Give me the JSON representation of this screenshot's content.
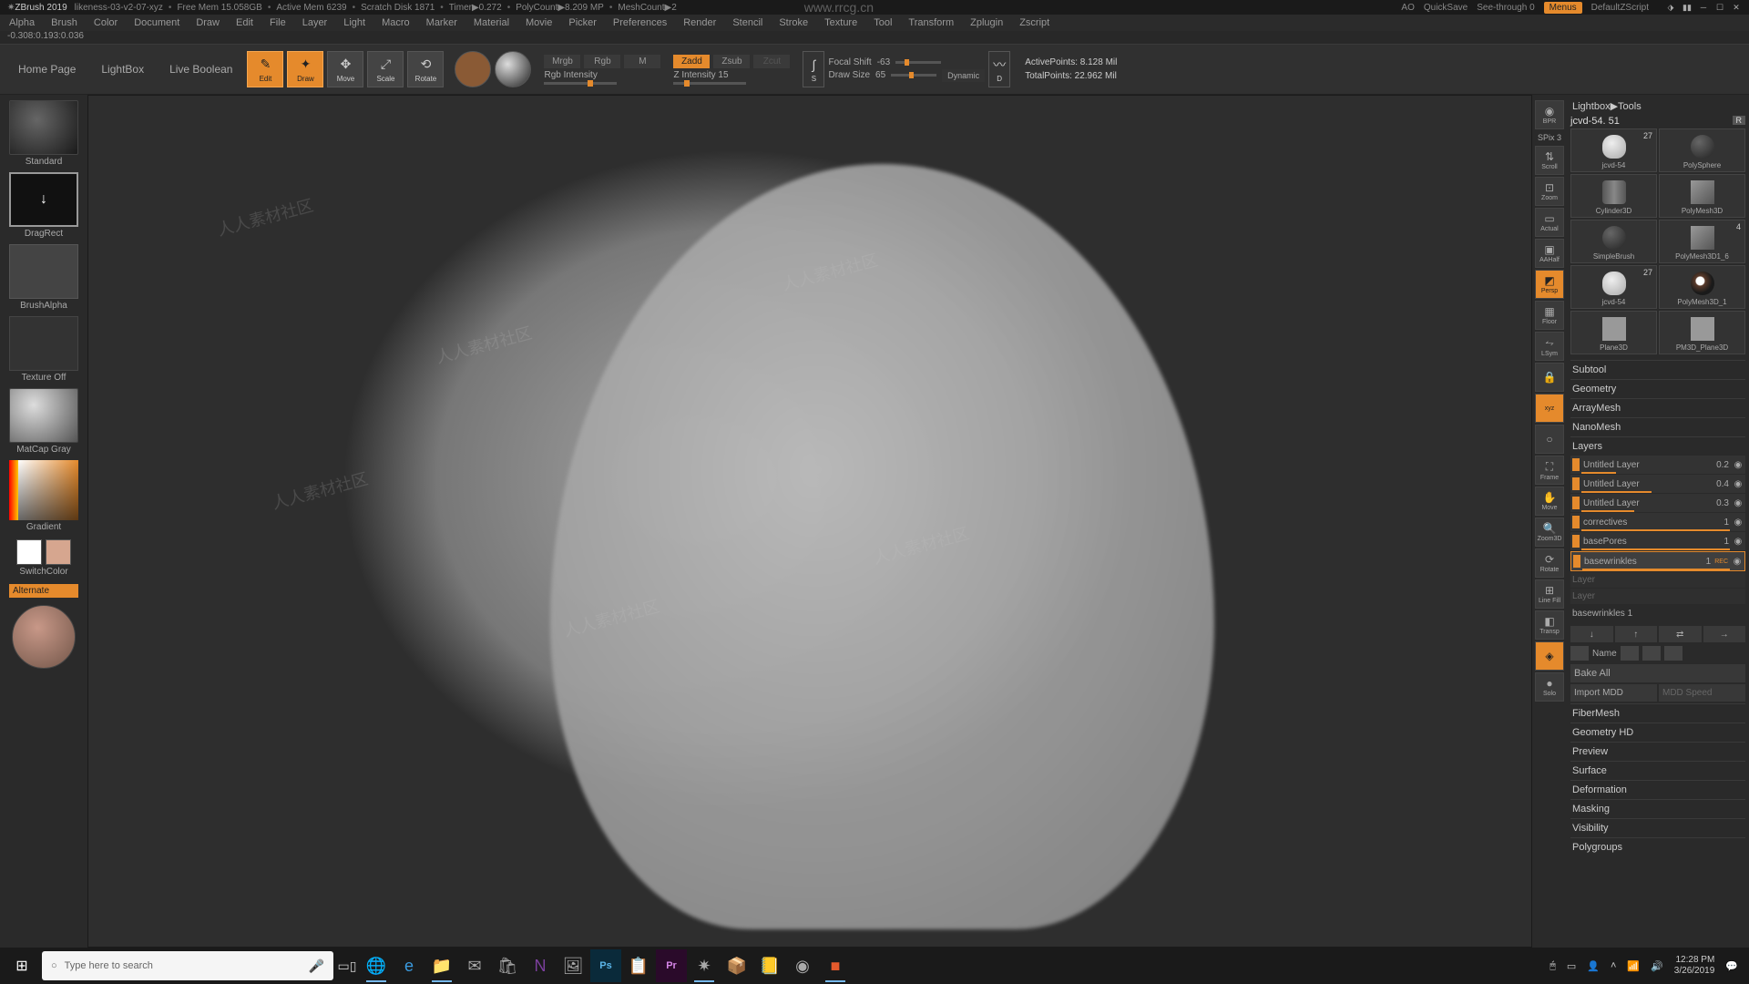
{
  "app_name": "ZBrush 2019",
  "document_name": "likeness-03-v2-07-xyz",
  "status_items": [
    "Free Mem 15.058GB",
    "Active Mem 6239",
    "Scratch Disk 1871",
    "Timer▶0.272",
    "PolyCount▶8.209 MP",
    "MeshCount▶2"
  ],
  "watermark_url": "www.rrcg.cn",
  "top_right": {
    "ao": "AO",
    "quicksave": "QuickSave",
    "seethrough": "See-through",
    "seethrough_val": "0",
    "menus": "Menus",
    "zscript": "DefaultZScript"
  },
  "menus": [
    "Alpha",
    "Brush",
    "Color",
    "Document",
    "Draw",
    "Edit",
    "File",
    "Layer",
    "Light",
    "Macro",
    "Marker",
    "Material",
    "Movie",
    "Picker",
    "Preferences",
    "Render",
    "Stencil",
    "Stroke",
    "Texture",
    "Tool",
    "Transform",
    "Zplugin",
    "Zscript"
  ],
  "coords": "-0.308:0.193:0.036",
  "toolbar": {
    "home": "Home Page",
    "lightbox": "LightBox",
    "liveb": "Live Boolean",
    "edit": "Edit",
    "draw": "Draw",
    "move": "Move",
    "scale": "Scale",
    "rotate": "Rotate",
    "mrgb": "Mrgb",
    "rgb": "Rgb",
    "m": "M",
    "rgb_int": "Rgb Intensity",
    "zadd": "Zadd",
    "zsub": "Zsub",
    "zcut": "Zcut",
    "zint": "Z Intensity",
    "zint_val": "15",
    "focal": "Focal Shift",
    "focal_val": "-63",
    "drawsize": "Draw Size",
    "drawsize_val": "65",
    "dynamic": "Dynamic",
    "active_pts": "ActivePoints: 8.128 Mil",
    "total_pts": "TotalPoints: 22.962 Mil"
  },
  "left": {
    "brush_name": "Standard",
    "stroke_name": "DragRect",
    "alpha_name": "BrushAlpha",
    "texture": "Texture Off",
    "material": "MatCap Gray",
    "gradient": "Gradient",
    "switch": "SwitchColor",
    "alternate": "Alternate"
  },
  "right_icons": [
    {
      "l": "BPR",
      "sub": ""
    },
    {
      "l": "SPix",
      "sub": "3"
    },
    {
      "l": "Scroll",
      "sub": ""
    },
    {
      "l": "Zoom",
      "sub": ""
    },
    {
      "l": "Actual",
      "sub": ""
    },
    {
      "l": "AAHalf",
      "sub": ""
    },
    {
      "l": "Persp",
      "sub": "",
      "active": true
    },
    {
      "l": "Floor",
      "sub": ""
    },
    {
      "l": "LSym",
      "sub": ""
    },
    {
      "l": "",
      "sub": "",
      "lock": true
    },
    {
      "l": "xyz",
      "sub": "",
      "active": true
    },
    {
      "l": "",
      "sub": ""
    },
    {
      "l": "Frame",
      "sub": ""
    },
    {
      "l": "Move",
      "sub": ""
    },
    {
      "l": "Zoom3D",
      "sub": ""
    },
    {
      "l": "Rotate",
      "sub": ""
    },
    {
      "l": "Line Fill",
      "sub": ""
    },
    {
      "l": "Transp",
      "sub": ""
    },
    {
      "l": "",
      "sub": "",
      "active": true
    },
    {
      "l": "Solo",
      "sub": ""
    }
  ],
  "tool": {
    "header": "Lightbox▶Tools",
    "name": "jcvd-54.",
    "name_num": "51",
    "r": "R",
    "subtools": [
      {
        "n": "jcvd-54",
        "c": "27",
        "shape": "head"
      },
      {
        "n": "PolySphere",
        "c": "",
        "shape": "sphere"
      },
      {
        "n": "Cylinder3D",
        "c": "",
        "shape": "cyl"
      },
      {
        "n": "PolyMesh3D",
        "c": "",
        "shape": "cube"
      },
      {
        "n": "SimpleBrush",
        "c": "",
        "shape": "sphere"
      },
      {
        "n": "PolyMesh3D1_6",
        "c": "4",
        "shape": "cube"
      },
      {
        "n": "jcvd-54",
        "c": "27",
        "shape": "head"
      },
      {
        "n": "PolyMesh3D_1",
        "c": "",
        "shape": "eye"
      },
      {
        "n": "Plane3D",
        "c": "",
        "shape": "plane"
      },
      {
        "n": "PM3D_Plane3D",
        "c": "",
        "shape": "plane"
      }
    ],
    "sections": [
      "Subtool",
      "Geometry",
      "ArrayMesh",
      "NanoMesh"
    ],
    "layers_h": "Layers",
    "layers": [
      {
        "n": "Untitled Layer",
        "v": "0.2",
        "bar": 20
      },
      {
        "n": "Untitled Layer",
        "v": "0.4",
        "bar": 40
      },
      {
        "n": "Untitled Layer",
        "v": "0.3",
        "bar": 30
      },
      {
        "n": "correctives",
        "v": "1",
        "bar": 100
      },
      {
        "n": "basePores",
        "v": "1",
        "bar": 100
      },
      {
        "n": "basewrinkles",
        "v": "1",
        "bar": 100,
        "sel": true,
        "rec": "REC"
      }
    ],
    "layer_empty": "Layer",
    "baselabel": "basewrinkles 1",
    "name_btn": "Name",
    "bakeall": "Bake All",
    "import_mdd": "Import MDD",
    "mdd_speed": "MDD Speed",
    "sections2": [
      "FiberMesh",
      "Geometry HD",
      "Preview",
      "Surface",
      "Deformation",
      "Masking",
      "Visibility",
      "Polygroups"
    ]
  },
  "taskbar": {
    "search_ph": "Type here to search",
    "time": "12:28 PM",
    "date": "3/26/2019"
  }
}
